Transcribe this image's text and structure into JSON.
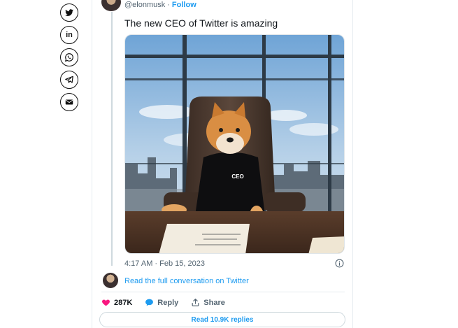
{
  "share": {
    "items": [
      {
        "name": "twitter"
      },
      {
        "name": "linkedin",
        "label": "in"
      },
      {
        "name": "whatsapp"
      },
      {
        "name": "telegram"
      },
      {
        "name": "email"
      }
    ]
  },
  "tweet": {
    "handle": "@elonmusk",
    "separator": "·",
    "follow_label": "Follow",
    "text": "The new CEO of Twitter is amazing",
    "image_caption": "CEO",
    "timestamp": "4:17 AM · Feb 15, 2023",
    "conversation_link": "Read the full conversation on Twitter"
  },
  "actions": {
    "likes": "287K",
    "reply_label": "Reply",
    "share_label": "Share"
  },
  "replies_button": "Read 10.9K replies",
  "colors": {
    "accent": "#1d9bf0",
    "like": "#f91880",
    "muted": "#536471"
  }
}
